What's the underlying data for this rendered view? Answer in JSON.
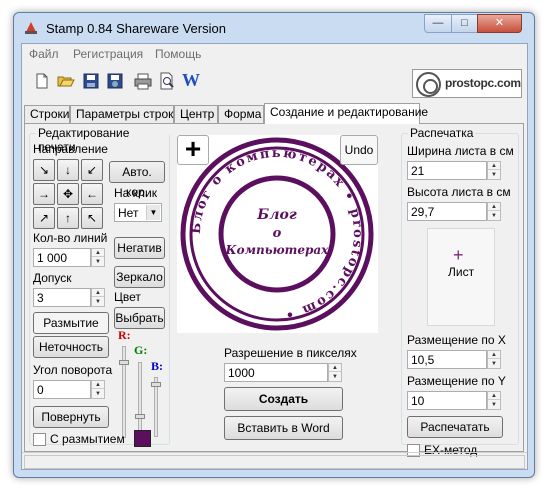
{
  "window": {
    "title": "Stamp 0.84 Shareware Version"
  },
  "menu": [
    "Файл",
    "Регистрация",
    "Помощь"
  ],
  "toolbar": {
    "icons": [
      "new-file-icon",
      "open-folder-icon",
      "save-icon",
      "save-as-icon",
      "print-icon",
      "print-preview-icon",
      "word-icon"
    ],
    "word_letter": "W",
    "logo_text": "prostopc.com"
  },
  "tabs": [
    {
      "label": "Строки",
      "active": false
    },
    {
      "label": "Параметры строк",
      "active": false
    },
    {
      "label": "Центр",
      "active": false
    },
    {
      "label": "Форма",
      "active": false
    },
    {
      "label": "Создание и редактирование",
      "active": true
    }
  ],
  "edit": {
    "group_title": "Редактирование печати",
    "direction_label": "Направление",
    "directions": [
      "↘",
      "↓",
      "↙",
      "→",
      "✥",
      "←",
      "↗",
      "↑",
      "↖"
    ],
    "auto_cor_button": "Авто. кор.",
    "on_click_label": "На клик",
    "on_click_value": "Нет",
    "lines_label": "Кол-во линий",
    "lines_value": "1 000",
    "negative_button": "Негатив",
    "tolerance_label": "Допуск",
    "tolerance_value": "3",
    "mirror_button": "Зеркало",
    "color_label": "Цвет",
    "choose_button": "Выбрать",
    "blur_button": "Размытие",
    "imprecision_button": "Неточность",
    "r_label": "R:",
    "g_label": "G:",
    "b_label": "B:",
    "angle_label": "Угол поворота",
    "angle_value": "0",
    "rotate_button": "Повернуть",
    "with_blur_label": "С размытием",
    "with_blur_checked": false,
    "swatch_color": "#5b0f5e"
  },
  "preview": {
    "plus_button": "+",
    "undo_button": "Undo",
    "stamp_color": "#5b0f5e",
    "outer_text": "Блог о компьютерах",
    "site_text": "prostopc.com",
    "center_line1": "Блог",
    "center_line2": "о",
    "center_line3": "Компьютерах"
  },
  "resolution": {
    "label": "Разрешение в пикселях",
    "value": "1000",
    "create_button": "Создать",
    "insert_word_button": "Вставить в Word"
  },
  "print": {
    "group_title": "Распечатка",
    "width_label": "Ширина листа в см",
    "width_value": "21",
    "height_label": "Высота листа в см",
    "height_value": "29,7",
    "sheet_label": "Лист",
    "pos_x_label": "Размещение по X",
    "pos_x_value": "10,5",
    "pos_y_label": "Размещение по Y",
    "pos_y_value": "10",
    "print_button": "Распечатать",
    "ex_method_label": "EX-метод",
    "ex_method_checked": false
  }
}
